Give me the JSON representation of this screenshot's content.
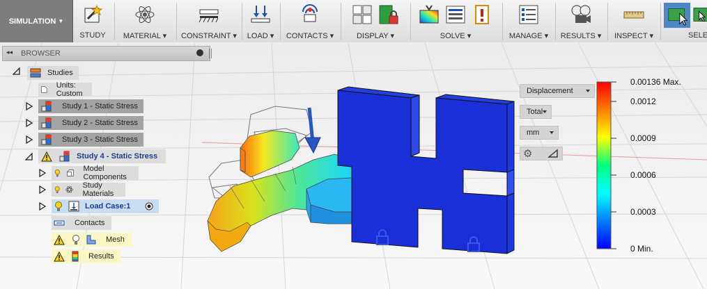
{
  "toolbar": {
    "workspace": "SIMULATION",
    "groups": {
      "study": "STUDY",
      "material": "MATERIAL",
      "constraint": "CONSTRAINT",
      "load": "LOAD",
      "contacts": "CONTACTS",
      "display": "DISPLAY",
      "solve": "SOLVE",
      "manage": "MANAGE",
      "results": "RESULTS",
      "inspect": "INSPECT",
      "select": "SELE"
    }
  },
  "browser": {
    "title": "BROWSER",
    "tree": {
      "studies": "Studies",
      "units": "Units: Custom",
      "study1": "Study 1 - Static Stress",
      "study2": "Study 2 - Static Stress",
      "study3": "Study 3 - Static Stress",
      "study4": "Study 4 - Static Stress",
      "model_components": "Model Components",
      "study_materials": "Study Materials",
      "load_case": "Load Case:1",
      "contacts": "Contacts",
      "mesh": "Mesh",
      "results": "Results"
    }
  },
  "legend": {
    "result_type": "Displacement",
    "component": "Total",
    "unit": "mm",
    "ticks": [
      "0.00136 Max.",
      "0.0012",
      "0.0009",
      "0.0006",
      "0.0003",
      "0 Min."
    ],
    "colors": [
      "#ff0000",
      "#ff8000",
      "#ffff00",
      "#00ff80",
      "#00ffff",
      "#0080ff",
      "#0000ff"
    ]
  }
}
